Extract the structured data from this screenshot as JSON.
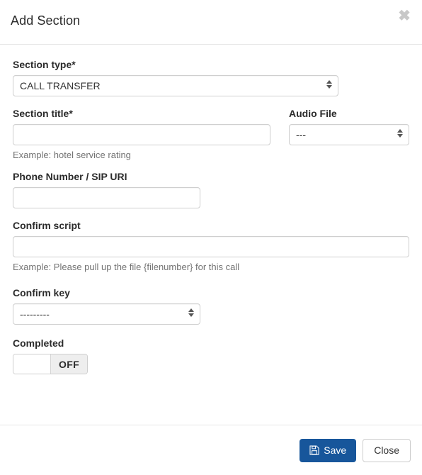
{
  "modal": {
    "title": "Add Section",
    "close_icon": "close-icon",
    "close_glyph": "✖"
  },
  "form": {
    "section_type": {
      "label": "Section type*",
      "value": "CALL TRANSFER",
      "options": [
        "CALL TRANSFER"
      ],
      "icon": "stepper-updown-icon"
    },
    "section_title": {
      "label": "Section title*",
      "value": "",
      "placeholder": "",
      "help": "Example: hotel service rating"
    },
    "audio_file": {
      "label": "Audio File",
      "value": "---",
      "options": [
        "---"
      ],
      "icon": "stepper-updown-icon"
    },
    "phone_number": {
      "label": "Phone Number / SIP URI",
      "value": "",
      "placeholder": ""
    },
    "confirm_script": {
      "label": "Confirm script",
      "value": "",
      "placeholder": "",
      "help": "Example: Please pull up the file {filenumber} for this call"
    },
    "confirm_key": {
      "label": "Confirm key",
      "value": "---------",
      "options": [
        "---------"
      ],
      "icon": "stepper-updown-icon"
    },
    "completed": {
      "label": "Completed",
      "state": "OFF",
      "checked": false
    }
  },
  "footer": {
    "save_label": "Save",
    "save_icon": "floppy-disk-save-icon",
    "close_label": "Close"
  },
  "colors": {
    "primary": "#17569b",
    "border": "#cfcfcf",
    "divider": "#e5e5e5",
    "help_text": "#737373",
    "toggle_off_bg": "#eeeeee",
    "close_icon": "#c8c8c8"
  }
}
